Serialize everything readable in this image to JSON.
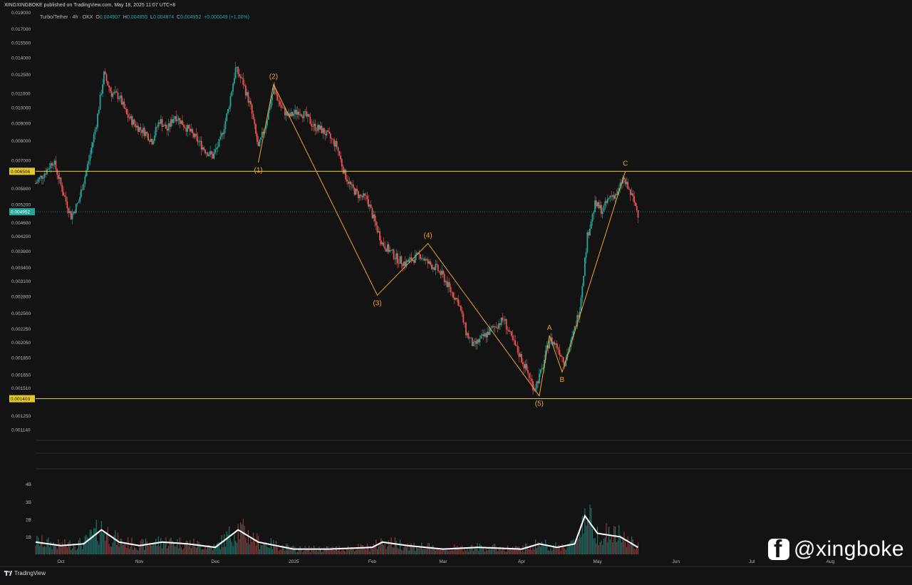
{
  "header": {
    "published_text": "XINGXINGBOKE published on TradingView.com, May 18, 2025 11:07 UTC+8"
  },
  "legend": {
    "symbol": "Turbo/Tether · 4h · OKX",
    "o_label": "O",
    "o_value": "0.004907",
    "h_label": "H",
    "h_value": "0.004955",
    "l_label": "L",
    "l_value": "0.004874",
    "c_label": "C",
    "c_value": "0.004952",
    "change": "+0.000049 (+1.00%)"
  },
  "footer": {
    "brand": "TradingView",
    "watermark": "@xingboke",
    "watermark_icon": "facebook-icon"
  },
  "colors": {
    "background": "#131313",
    "up": "#26a69a",
    "down": "#ef5350",
    "wave": "#f0a030",
    "level": "#e5c82b",
    "current": "#26a69a"
  },
  "chart_data": {
    "type": "candlestick",
    "interval": "4h",
    "y_scale": "log",
    "ylim": [
      0.00108,
      0.0195
    ],
    "y_ticks": [
      "0.019000",
      "0.017000",
      "0.015500",
      "0.014000",
      "0.012500",
      "0.011000",
      "0.010000",
      "0.009000",
      "0.008000",
      "0.007000",
      "0.005800",
      "0.005200",
      "0.004600",
      "0.004200",
      "0.003800",
      "0.003400",
      "0.003100",
      "0.002800",
      "0.002500",
      "0.002250",
      "0.002050",
      "0.001850",
      "0.001650",
      "0.001510",
      "0.001250",
      "0.001140"
    ],
    "x_ticks": [
      {
        "label": "Oct",
        "date": "2024-10-01"
      },
      {
        "label": "Nov",
        "date": "2024-11-01"
      },
      {
        "label": "Dec",
        "date": "2024-12-01"
      },
      {
        "label": "2025",
        "date": "2025-01-01"
      },
      {
        "label": "Feb",
        "date": "2025-02-01"
      },
      {
        "label": "Mar",
        "date": "2025-03-01"
      },
      {
        "label": "Apr",
        "date": "2025-04-01"
      },
      {
        "label": "May",
        "date": "2025-05-01"
      },
      {
        "label": "Jun",
        "date": "2025-06-01"
      },
      {
        "label": "Jul",
        "date": "2025-07-01"
      },
      {
        "label": "Aug",
        "date": "2025-08-01"
      }
    ],
    "x_range": [
      "2024-09-21",
      "2025-08-31"
    ],
    "price_path": [
      [
        "2024-09-21",
        0.006
      ],
      [
        "2024-09-25",
        0.0065
      ],
      [
        "2024-09-28",
        0.007
      ],
      [
        "2024-10-02",
        0.0056
      ],
      [
        "2024-10-05",
        0.0048
      ],
      [
        "2024-10-08",
        0.0053
      ],
      [
        "2024-10-12",
        0.007
      ],
      [
        "2024-10-15",
        0.009
      ],
      [
        "2024-10-18",
        0.0125
      ],
      [
        "2024-10-21",
        0.011
      ],
      [
        "2024-10-24",
        0.0108
      ],
      [
        "2024-10-27",
        0.0095
      ],
      [
        "2024-10-31",
        0.0088
      ],
      [
        "2024-11-03",
        0.0085
      ],
      [
        "2024-11-06",
        0.008
      ],
      [
        "2024-11-09",
        0.0092
      ],
      [
        "2024-11-12",
        0.0086
      ],
      [
        "2024-11-15",
        0.0095
      ],
      [
        "2024-11-18",
        0.009
      ],
      [
        "2024-11-21",
        0.0085
      ],
      [
        "2024-11-24",
        0.008
      ],
      [
        "2024-11-27",
        0.0075
      ],
      [
        "2024-11-30",
        0.0072
      ],
      [
        "2024-12-03",
        0.008
      ],
      [
        "2024-12-06",
        0.0098
      ],
      [
        "2024-12-09",
        0.013
      ],
      [
        "2024-12-12",
        0.0118
      ],
      [
        "2024-12-15",
        0.01
      ],
      [
        "2024-12-18",
        0.0076
      ],
      [
        "2024-12-21",
        0.009
      ],
      [
        "2024-12-24",
        0.0114
      ],
      [
        "2024-12-27",
        0.01
      ],
      [
        "2024-12-30",
        0.0094
      ],
      [
        "2025-01-03",
        0.0098
      ],
      [
        "2025-01-06",
        0.0094
      ],
      [
        "2025-01-09",
        0.0088
      ],
      [
        "2025-01-12",
        0.0086
      ],
      [
        "2025-01-15",
        0.0082
      ],
      [
        "2025-01-18",
        0.0077
      ],
      [
        "2025-01-21",
        0.0064
      ],
      [
        "2025-01-24",
        0.0058
      ],
      [
        "2025-01-27",
        0.0055
      ],
      [
        "2025-01-30",
        0.0054
      ],
      [
        "2025-02-02",
        0.0046
      ],
      [
        "2025-02-05",
        0.004
      ],
      [
        "2025-02-08",
        0.0038
      ],
      [
        "2025-02-11",
        0.0036
      ],
      [
        "2025-02-14",
        0.0035
      ],
      [
        "2025-02-17",
        0.0036
      ],
      [
        "2025-02-20",
        0.0037
      ],
      [
        "2025-02-23",
        0.0035
      ],
      [
        "2025-02-26",
        0.0034
      ],
      [
        "2025-03-01",
        0.0032
      ],
      [
        "2025-03-04",
        0.0029
      ],
      [
        "2025-03-07",
        0.0027
      ],
      [
        "2025-03-10",
        0.0022
      ],
      [
        "2025-03-13",
        0.002
      ],
      [
        "2025-03-16",
        0.0021
      ],
      [
        "2025-03-19",
        0.0022
      ],
      [
        "2025-03-22",
        0.0023
      ],
      [
        "2025-03-25",
        0.0024
      ],
      [
        "2025-03-28",
        0.0021
      ],
      [
        "2025-03-31",
        0.0019
      ],
      [
        "2025-04-03",
        0.0017
      ],
      [
        "2025-04-06",
        0.0015
      ],
      [
        "2025-04-09",
        0.0017
      ],
      [
        "2025-04-12",
        0.0021
      ],
      [
        "2025-04-15",
        0.002
      ],
      [
        "2025-04-18",
        0.0018
      ],
      [
        "2025-04-21",
        0.0021
      ],
      [
        "2025-04-24",
        0.0026
      ],
      [
        "2025-04-27",
        0.0042
      ],
      [
        "2025-04-30",
        0.0052
      ],
      [
        "2025-05-03",
        0.005
      ],
      [
        "2025-05-06",
        0.0055
      ],
      [
        "2025-05-09",
        0.0056
      ],
      [
        "2025-05-11",
        0.0062
      ],
      [
        "2025-05-13",
        0.0058
      ],
      [
        "2025-05-15",
        0.0054
      ],
      [
        "2025-05-17",
        0.0049
      ]
    ],
    "horizontal_levels": [
      {
        "price": 0.006506,
        "label": "0.006506"
      },
      {
        "price": 0.001403,
        "label": "0.001403"
      }
    ],
    "current_price": {
      "price": 0.004952,
      "label": "0.004952"
    },
    "wave_points": [
      {
        "date": "2024-12-18",
        "price": 0.0069,
        "label": "(1)",
        "label_pos": "below"
      },
      {
        "date": "2024-12-24",
        "price": 0.0117,
        "label": "(2)",
        "label_pos": "above"
      },
      {
        "date": "2025-02-03",
        "price": 0.00282,
        "label": "(3)",
        "label_pos": "below"
      },
      {
        "date": "2025-02-23",
        "price": 0.004,
        "label": "(4)",
        "label_pos": "above"
      },
      {
        "date": "2025-04-08",
        "price": 0.00143,
        "label": "(5)",
        "label_pos": "below"
      },
      {
        "date": "2025-04-12",
        "price": 0.00215,
        "label": "A",
        "label_pos": "above"
      },
      {
        "date": "2025-04-17",
        "price": 0.00168,
        "label": "B",
        "label_pos": "below"
      },
      {
        "date": "2025-05-12",
        "price": 0.0065,
        "label": "C",
        "label_pos": "above"
      }
    ],
    "volume": {
      "y_ticks": [
        {
          "label": "4B",
          "value": 4
        },
        {
          "label": "3B",
          "value": 3
        },
        {
          "label": "2B",
          "value": 2
        },
        {
          "label": "1B",
          "value": 1
        }
      ],
      "ylim": [
        0,
        4.8
      ],
      "unit": "B",
      "path": [
        [
          "2024-09-21",
          0.7
        ],
        [
          "2024-10-01",
          0.5
        ],
        [
          "2024-10-10",
          0.6
        ],
        [
          "2024-10-17",
          1.4
        ],
        [
          "2024-10-24",
          0.7
        ],
        [
          "2024-11-01",
          0.5
        ],
        [
          "2024-11-10",
          0.7
        ],
        [
          "2024-11-20",
          0.6
        ],
        [
          "2024-12-01",
          0.4
        ],
        [
          "2024-12-10",
          1.4
        ],
        [
          "2024-12-18",
          0.7
        ],
        [
          "2025-01-01",
          0.3
        ],
        [
          "2025-01-15",
          0.3
        ],
        [
          "2025-02-01",
          0.4
        ],
        [
          "2025-02-05",
          0.7
        ],
        [
          "2025-02-15",
          0.5
        ],
        [
          "2025-03-01",
          0.3
        ],
        [
          "2025-03-15",
          0.4
        ],
        [
          "2025-04-01",
          0.3
        ],
        [
          "2025-04-08",
          0.6
        ],
        [
          "2025-04-15",
          0.4
        ],
        [
          "2025-04-22",
          0.6
        ],
        [
          "2025-04-26",
          2.2
        ],
        [
          "2025-05-01",
          1.2
        ],
        [
          "2025-05-10",
          1.0
        ],
        [
          "2025-05-17",
          0.4
        ]
      ]
    }
  }
}
